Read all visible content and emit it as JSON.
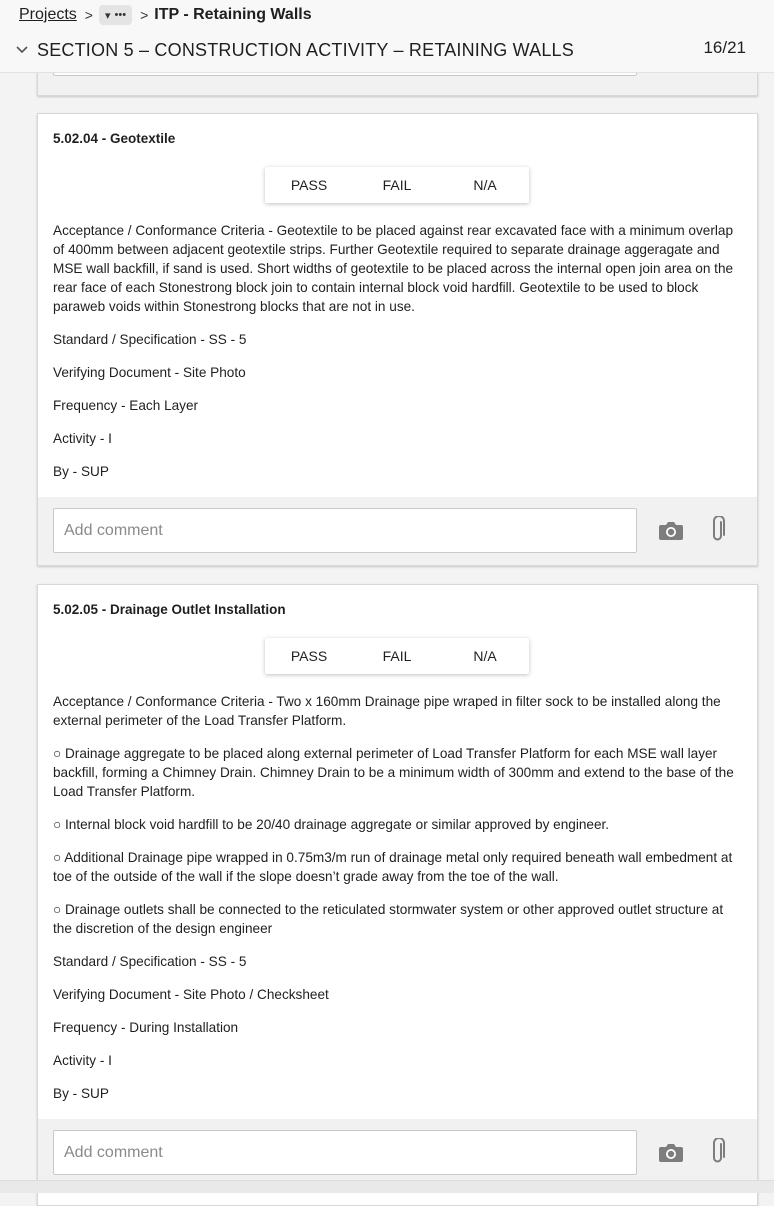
{
  "breadcrumb": {
    "projects": "Projects",
    "current": "ITP - Retaining Walls"
  },
  "section": {
    "title": "SECTION 5 – CONSTRUCTION ACTIVITY – RETAINING WALLS",
    "progress": "16/21"
  },
  "options": {
    "pass": "PASS",
    "fail": "FAIL",
    "na": "N/A"
  },
  "comment_placeholder": "Add comment",
  "items": [
    {
      "title": "5.02.04 - Geotextile",
      "paragraphs": [
        "Acceptance / Conformance Criteria - Geotextile to be placed against rear excavated face with a minimum overlap of 400mm between adjacent geotextile strips. Further Geotextile required to separate drainage aggeragate and MSE wall backfill, if sand is used. Short widths of geotextile to be placed across the internal open join area on the rear face of each Stonestrong block join to contain internal block void hardfill. Geotextile to be used to block paraweb voids within Stonestrong blocks that are not in use.",
        "Standard / Specification - SS - 5",
        "Verifying Document - Site Photo",
        "Frequency - Each Layer",
        "Activity - I",
        "By - SUP"
      ]
    },
    {
      "title": "5.02.05 - Drainage Outlet Installation",
      "paragraphs": [
        "Acceptance / Conformance Criteria - Two x 160mm Drainage pipe wraped in filter sock to be installed along the external perimeter of the Load Transfer Platform.",
        "○ Drainage aggregate to be placed along external perimeter of Load Transfer Platform for each MSE wall layer backfill, forming a Chimney Drain. Chimney Drain to be a minimum width of 300mm and extend to the base of the Load Transfer Platform.",
        "○ Internal block void hardfill to be 20/40 drainage aggregate or similar approved by engineer.",
        "○ Additional Drainage pipe wrapped in 0.75m3/m run of drainage metal only required beneath wall embedment at toe of the outside of the wall if the slope doesn’t grade away from the toe of the wall.",
        "○ Drainage outlets shall be connected to the reticulated stormwater system or other approved outlet structure at the discretion of the design engineer",
        "Standard / Specification - SS - 5",
        "Verifying Document - Site Photo / Checksheet",
        "Frequency - During Installation",
        "Activity - I",
        "By - SUP"
      ]
    }
  ]
}
